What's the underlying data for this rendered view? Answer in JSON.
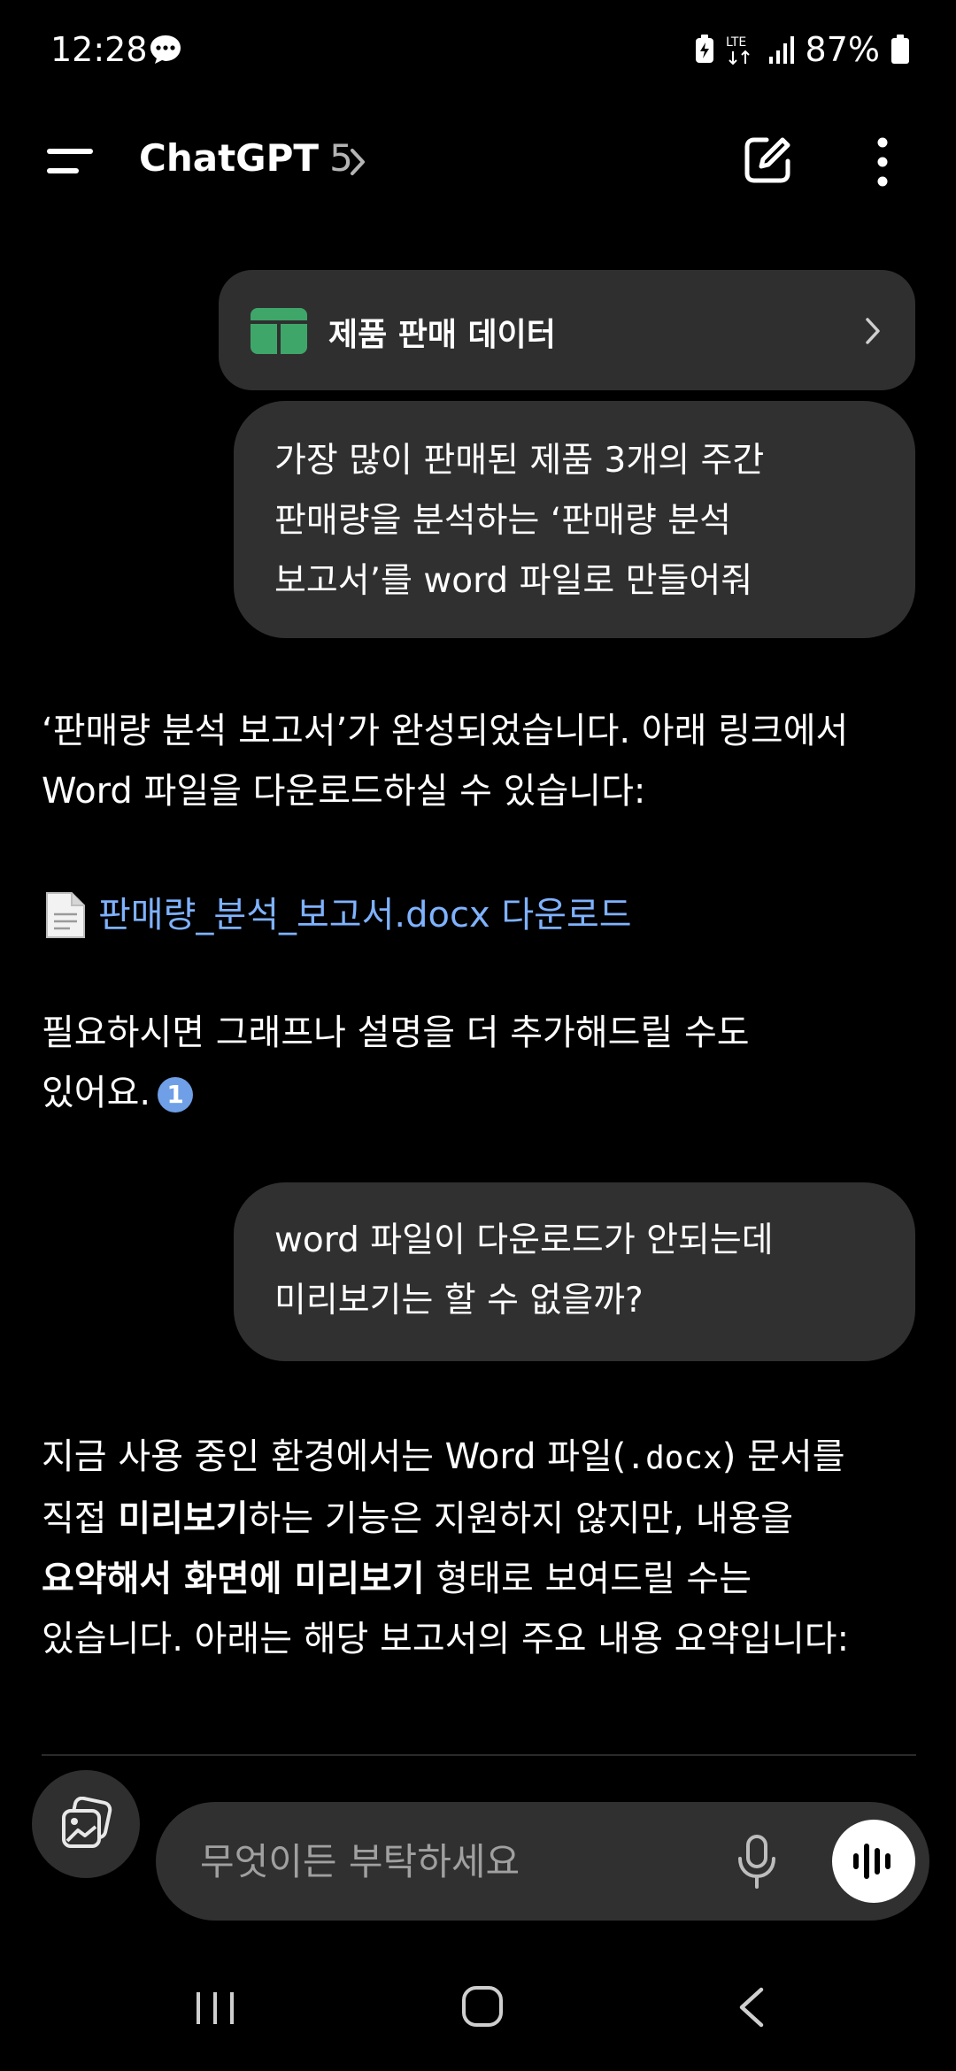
{
  "status_bar": {
    "time": "12:28",
    "network": "LTE",
    "battery": "87%"
  },
  "header": {
    "title": "ChatGPT",
    "model": "5"
  },
  "chat": {
    "file_card": {
      "title": "제품 판매 데이터"
    },
    "user_message_1": {
      "line1": "가장 많이 판매된 제품 3개의 주간",
      "line2": "판매량을 분석하는 ‘판매량 분석",
      "line3": "보고서’를 word 파일로 만들어줘"
    },
    "assistant_message_1": {
      "line1": "‘판매량 분석 보고서’가 완성되었습니다. 아래 링크에서",
      "line2": "Word 파일을 다운로드하실 수 있습니다:",
      "link_text": "판매량_분석_보고서.docx 다운로드",
      "p2_line1": "필요하시면 그래프나 설명을 더 추가해드릴 수도",
      "p2_line2": "있어요.",
      "citation": "1"
    },
    "user_message_2": {
      "line1": "word 파일이 다운로드가 안되는데",
      "line2": "미리보기는 할 수 없을까?"
    },
    "assistant_message_2": {
      "l1_a": "지금 사용 중인 환경에서는 Word 파일(",
      "l1_code": ".docx",
      "l1_b": ") 문서를",
      "l2_a": "직접 ",
      "l2_bold": "미리보기",
      "l2_b": "하는 기능은 지원하지 않지만, 내용을",
      "l3_bold": "요약해서 화면에 미리보기",
      "l3_b": " 형태로 보여드릴 수는",
      "l4": "있습니다. 아래는 해당 보고서의 주요 내용 요약입니다:"
    }
  },
  "composer": {
    "placeholder": "무엇이든 부탁하세요"
  },
  "colors": {
    "background": "#000000",
    "bubble": "#303030",
    "link": "#7fb2ff",
    "sheet_icon": "#3fa66a"
  }
}
